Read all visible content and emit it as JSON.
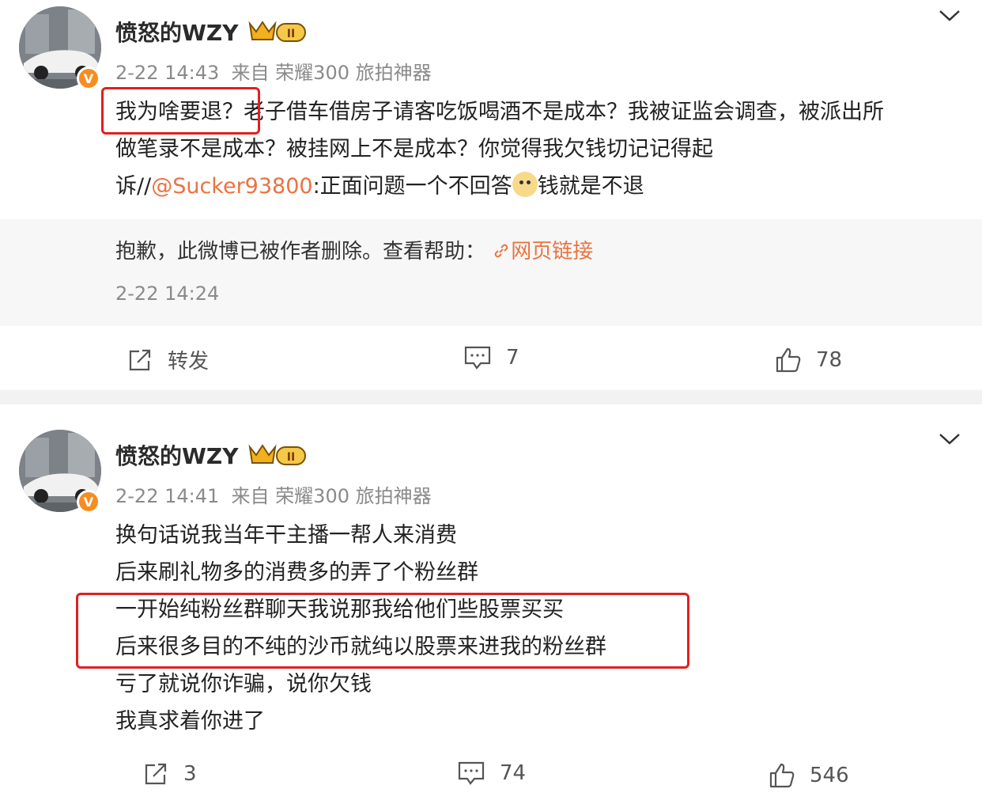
{
  "posts": [
    {
      "username": "愤怒的WZY",
      "time": "2-22 14:43",
      "source_prefix": "来自",
      "source": "荣耀300 旅拍神器",
      "lines": [
        "老子借车借房子请客吃饭喝酒不是成本？我被证监会调查，被派出所",
        "做笔录不是成本？被挂网上不是成本？你觉得我欠钱切记记得起"
      ],
      "highlight": "我为啥要退？",
      "line3_prefix": "诉//",
      "mention": "@Sucker93800",
      "line3_text_a": ":正面问题一个不回答",
      "line3_text_b": "钱就是不退",
      "quote": {
        "text": "抱歉，此微博已被作者删除。查看帮助：",
        "link_icon": "link-icon",
        "link": "网页链接",
        "time": "2-22 14:24"
      },
      "actions": {
        "repost": "转发",
        "comments": "7",
        "likes": "78"
      }
    },
    {
      "username": "愤怒的WZY",
      "time": "2-22 14:41",
      "source_prefix": "来自",
      "source": "荣耀300 旅拍神器",
      "lines": [
        "换句话说我当年干主播一帮人来消费",
        "后来刷礼物多的消费多的弄了个粉丝群",
        "一开始纯粉丝群聊天我说那我给他们些股票买买",
        "后来很多目的不纯的沙币就纯以股票来进我的粉丝群",
        "亏了就说你诈骗，说你欠钱",
        "我真求着你进了"
      ],
      "actions": {
        "repost": "3",
        "comments": "74",
        "likes": "546"
      }
    }
  ],
  "colors": {
    "accent": "#eb7340",
    "highlight_box": "#e02020",
    "badge": "#f78c1f"
  }
}
